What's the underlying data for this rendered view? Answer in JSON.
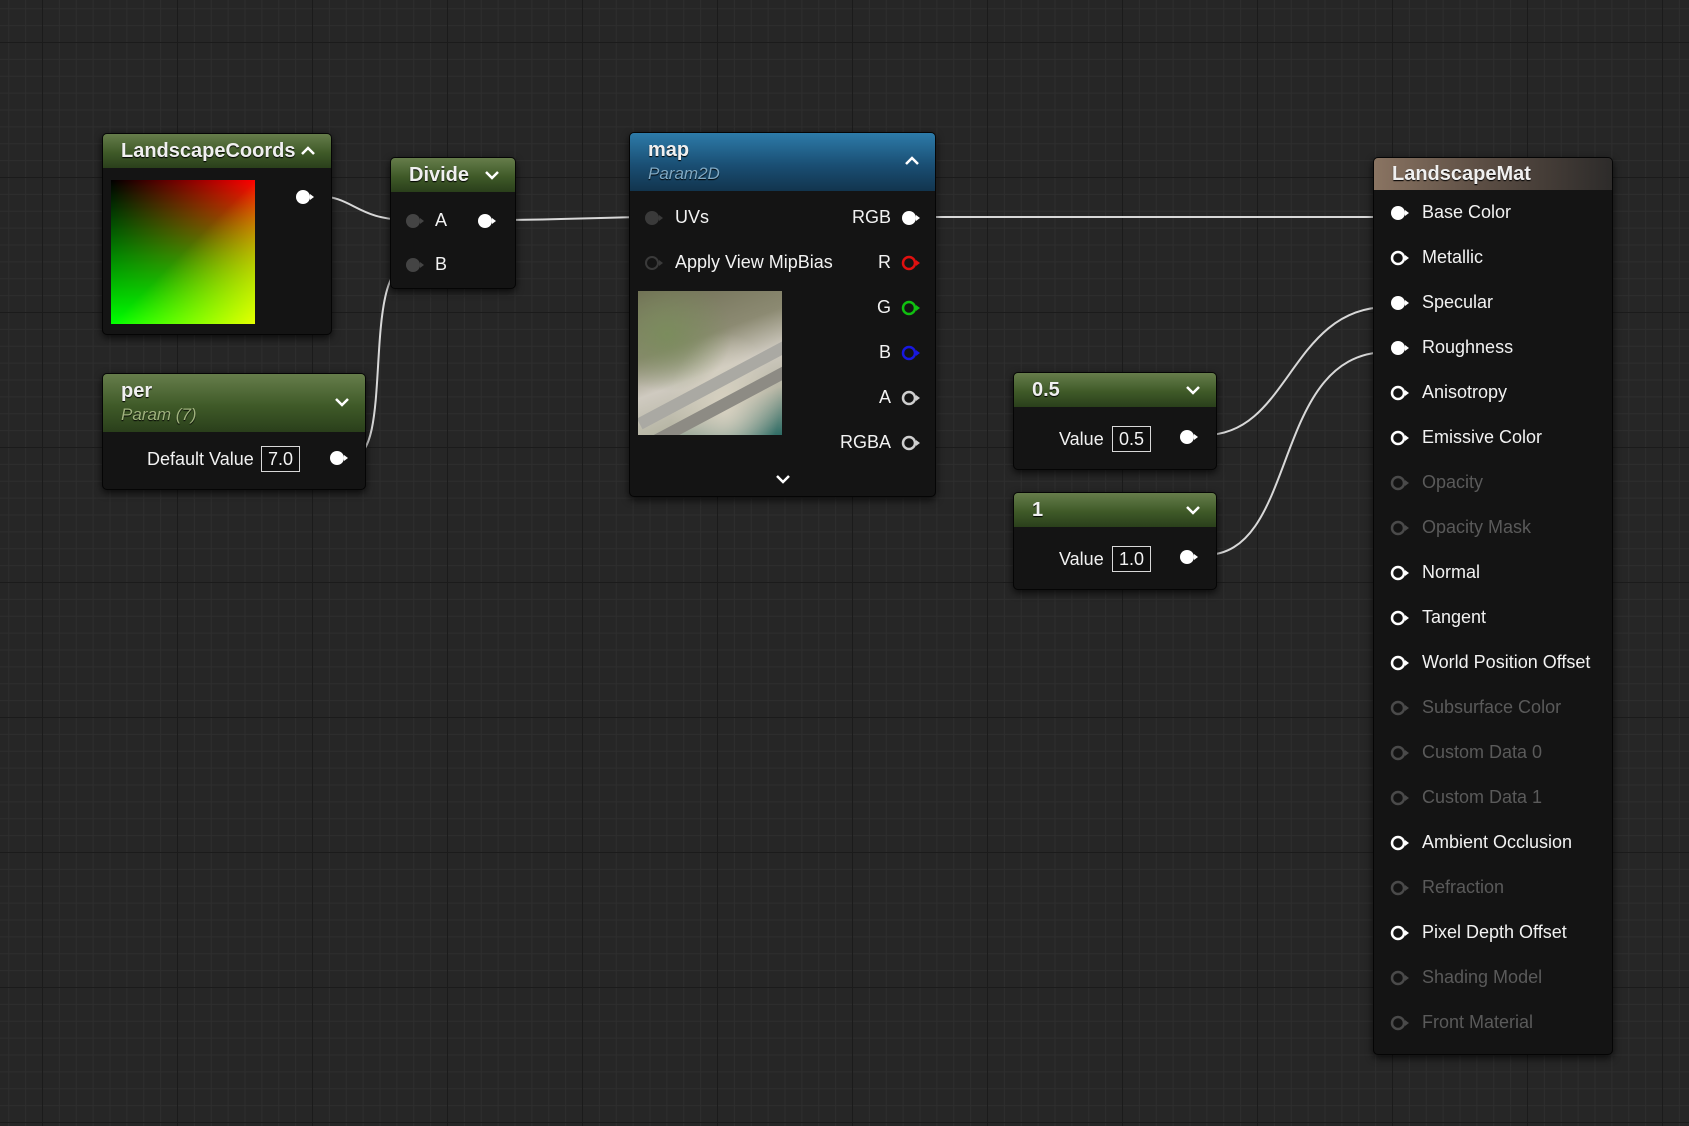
{
  "nodes": {
    "landscape_coords": {
      "title": "LandscapeCoords"
    },
    "divide": {
      "title": "Divide",
      "inputs": [
        "A",
        "B"
      ]
    },
    "per": {
      "title": "per",
      "subtitle": "Param (7)",
      "default_label": "Default Value",
      "default_value": "7.0"
    },
    "map": {
      "title": "map",
      "subtitle": "Param2D",
      "inputs": [
        "UVs",
        "Apply View MipBias"
      ],
      "outputs": [
        "RGB",
        "R",
        "G",
        "B",
        "A",
        "RGBA"
      ]
    },
    "const_05": {
      "title": "0.5",
      "value_label": "Value",
      "value": "0.5"
    },
    "const_1": {
      "title": "1",
      "value_label": "Value",
      "value": "1.0"
    },
    "landscape_mat": {
      "title": "LandscapeMat",
      "inputs": [
        {
          "label": "Base Color",
          "enabled": true,
          "connected": true
        },
        {
          "label": "Metallic",
          "enabled": true,
          "connected": false
        },
        {
          "label": "Specular",
          "enabled": true,
          "connected": true
        },
        {
          "label": "Roughness",
          "enabled": true,
          "connected": true
        },
        {
          "label": "Anisotropy",
          "enabled": true,
          "connected": false
        },
        {
          "label": "Emissive Color",
          "enabled": true,
          "connected": false
        },
        {
          "label": "Opacity",
          "enabled": false,
          "connected": false
        },
        {
          "label": "Opacity Mask",
          "enabled": false,
          "connected": false
        },
        {
          "label": "Normal",
          "enabled": true,
          "connected": false
        },
        {
          "label": "Tangent",
          "enabled": true,
          "connected": false
        },
        {
          "label": "World Position Offset",
          "enabled": true,
          "connected": false
        },
        {
          "label": "Subsurface Color",
          "enabled": false,
          "connected": false
        },
        {
          "label": "Custom Data 0",
          "enabled": false,
          "connected": false
        },
        {
          "label": "Custom Data 1",
          "enabled": false,
          "connected": false
        },
        {
          "label": "Ambient Occlusion",
          "enabled": true,
          "connected": false
        },
        {
          "label": "Refraction",
          "enabled": false,
          "connected": false
        },
        {
          "label": "Pixel Depth Offset",
          "enabled": true,
          "connected": false
        },
        {
          "label": "Shading Model",
          "enabled": false,
          "connected": false
        },
        {
          "label": "Front Material",
          "enabled": false,
          "connected": false
        }
      ]
    }
  },
  "colors": {
    "wire": "#d8d8d8",
    "pin_r": "#e01010",
    "pin_g": "#10c010",
    "pin_b": "#1818e0",
    "pin_white": "#ffffff",
    "disabled": "#5a5a5a"
  }
}
